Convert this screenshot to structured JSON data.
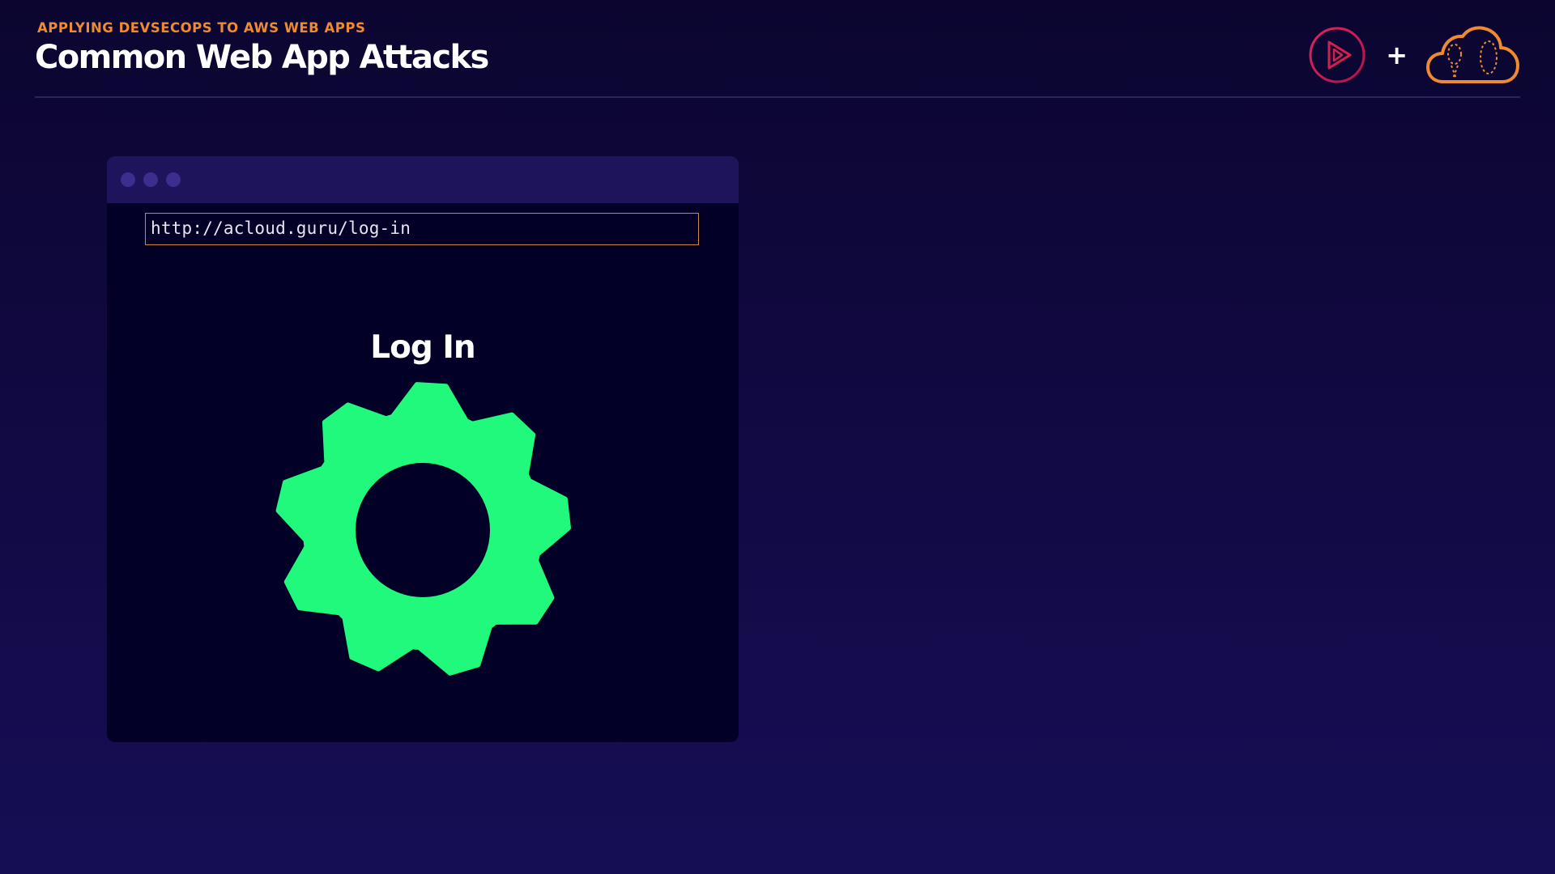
{
  "header": {
    "overline": "APPLYING DEVSECOPS TO AWS WEB APPS",
    "title": "Common Web App Attacks"
  },
  "logos": {
    "left_icon": "play-logo-icon",
    "separator": "+",
    "right_icon": "cloud-logo-icon"
  },
  "browser": {
    "address": "http://acloud.guru/log-in",
    "heading": "Log In",
    "icon": "gear-icon"
  },
  "colors": {
    "accent_orange": "#f08a2f",
    "gear_green": "#20f97c",
    "logo_pink": "#d2214f",
    "background": "#120a45",
    "browser_bar": "#1e145c"
  }
}
